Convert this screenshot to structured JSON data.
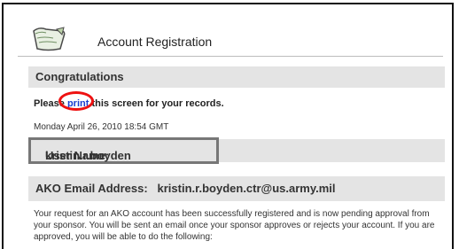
{
  "header": {
    "title": "Account Registration",
    "icon": "scroll-icon"
  },
  "congratulations": {
    "title": "Congratulations",
    "print_before": "Plea",
    "print_mid1": "se ",
    "print_link": "print",
    "print_mid2": " th",
    "print_after": "is screen for your records.",
    "date": "Monday April 26, 2010 18:54 GMT"
  },
  "username": {
    "label": "User Name:",
    "value": "kristin.r.boyden"
  },
  "email": {
    "label": "AKO Email Address:",
    "value": "kristin.r.boyden.ctr@us.army.mil"
  },
  "body_text": "Your request for an AKO account has been successfully registered and is now pending approval from your sponsor. You will be sent an email once your sponsor approves or rejects your account. If you are approved, you will be able to do the following:",
  "colors": {
    "link": "#1a3fd0",
    "highlight": "#e11111",
    "bar": "#e4e4e4"
  }
}
